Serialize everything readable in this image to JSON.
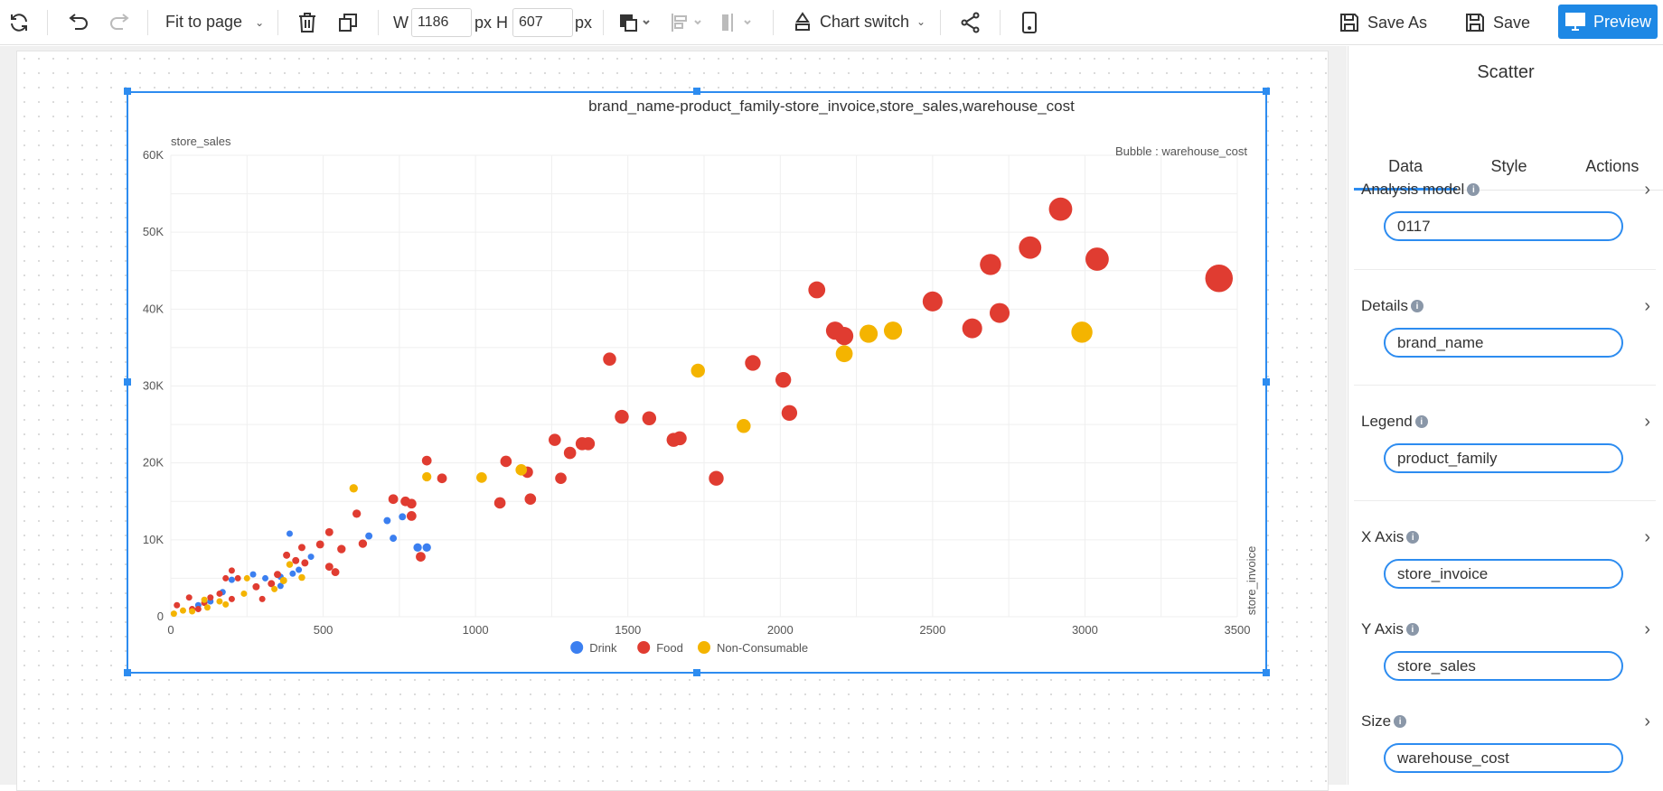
{
  "toolbar": {
    "zoom": "Fit to page",
    "w_label": "W",
    "width_value": "1186",
    "px1": "px",
    "h_label": "H",
    "height_value": "607",
    "px2": "px",
    "chart_switch": "Chart switch",
    "save_as": "Save As",
    "save": "Save",
    "preview": "Preview"
  },
  "chart": {
    "title": "brand_name-product_family-store_invoice,store_sales,warehouse_cost",
    "ylabel": "store_sales",
    "xlabel": "store_invoice",
    "bubble_note": "Bubble : warehouse_cost"
  },
  "chart_data": {
    "type": "scatter",
    "title": "brand_name-product_family-store_invoice,store_sales,warehouse_cost",
    "xlabel": "store_invoice",
    "ylabel": "store_sales",
    "size_label": "Bubble : warehouse_cost",
    "xlim": [
      0,
      3500
    ],
    "ylim": [
      0,
      60000
    ],
    "x_ticks": [
      "0",
      "500",
      "1000",
      "1500",
      "2000",
      "2500",
      "3000",
      "3500"
    ],
    "y_ticks": [
      "0",
      "10K",
      "20K",
      "30K",
      "40K",
      "50K",
      "60K"
    ],
    "legend_position": "bottom",
    "grid": true,
    "series": [
      {
        "name": "Drink",
        "color": "#3b7ff0",
        "points": [
          [
            390,
            10800,
            1
          ],
          [
            650,
            10500,
            1.2
          ],
          [
            710,
            12500,
            1.2
          ],
          [
            760,
            13000,
            1.2
          ],
          [
            730,
            10200,
            1.2
          ],
          [
            810,
            9000,
            1.5
          ],
          [
            840,
            9000,
            1.5
          ],
          [
            460,
            7800,
            1
          ],
          [
            420,
            6100,
            1
          ],
          [
            400,
            5600,
            1
          ],
          [
            360,
            5200,
            1
          ],
          [
            310,
            5000,
            1
          ],
          [
            270,
            5500,
            1
          ],
          [
            200,
            4800,
            1
          ],
          [
            170,
            3200,
            1
          ],
          [
            360,
            4000,
            1
          ],
          [
            130,
            2000,
            1
          ],
          [
            90,
            1500,
            1
          ]
        ]
      },
      {
        "name": "Food",
        "color": "#e03c31",
        "points": [
          [
            3440,
            44000,
            6
          ],
          [
            2920,
            53000,
            5
          ],
          [
            3040,
            46500,
            5
          ],
          [
            2820,
            48000,
            4.8
          ],
          [
            2690,
            45800,
            4.5
          ],
          [
            2500,
            41000,
            4.2
          ],
          [
            2720,
            39500,
            4.2
          ],
          [
            2630,
            37500,
            4.2
          ],
          [
            2120,
            42500,
            3.5
          ],
          [
            2180,
            37200,
            3.8
          ],
          [
            2210,
            36500,
            3.8
          ],
          [
            1910,
            33000,
            3.2
          ],
          [
            2010,
            30800,
            3.2
          ],
          [
            2030,
            26500,
            3.2
          ],
          [
            1440,
            33500,
            2.6
          ],
          [
            1480,
            26000,
            2.8
          ],
          [
            1570,
            25800,
            2.8
          ],
          [
            1650,
            23000,
            2.8
          ],
          [
            1670,
            23200,
            2.8
          ],
          [
            1790,
            18000,
            3
          ],
          [
            1260,
            23000,
            2.4
          ],
          [
            1310,
            21300,
            2.4
          ],
          [
            1350,
            22500,
            2.6
          ],
          [
            1370,
            22500,
            2.6
          ],
          [
            1280,
            18000,
            2.2
          ],
          [
            1100,
            20200,
            2.2
          ],
          [
            1170,
            18800,
            2.2
          ],
          [
            1180,
            15300,
            2.2
          ],
          [
            1080,
            14800,
            2.2
          ],
          [
            840,
            20300,
            1.8
          ],
          [
            890,
            18000,
            1.8
          ],
          [
            770,
            15000,
            1.8
          ],
          [
            730,
            15300,
            1.8
          ],
          [
            790,
            14700,
            1.8
          ],
          [
            790,
            13100,
            1.8
          ],
          [
            820,
            7800,
            1.8
          ],
          [
            610,
            13400,
            1.5
          ],
          [
            560,
            8800,
            1.5
          ],
          [
            630,
            9500,
            1.5
          ],
          [
            520,
            11000,
            1.4
          ],
          [
            490,
            9400,
            1.4
          ],
          [
            520,
            6500,
            1.4
          ],
          [
            540,
            5800,
            1.4
          ],
          [
            440,
            7000,
            1.2
          ],
          [
            430,
            9000,
            1.2
          ],
          [
            380,
            8000,
            1.2
          ],
          [
            410,
            7300,
            1.2
          ],
          [
            350,
            5500,
            1.2
          ],
          [
            330,
            4300,
            1.2
          ],
          [
            280,
            3900,
            1.2
          ],
          [
            200,
            6000,
            1
          ],
          [
            180,
            5000,
            1
          ],
          [
            220,
            5000,
            1
          ],
          [
            160,
            3000,
            1
          ],
          [
            130,
            2500,
            1
          ],
          [
            110,
            1800,
            1
          ],
          [
            90,
            1000,
            1
          ],
          [
            60,
            2500,
            1
          ],
          [
            20,
            1500,
            1
          ],
          [
            300,
            2300,
            1
          ],
          [
            200,
            2300,
            1
          ],
          [
            70,
            1000,
            1
          ]
        ]
      },
      {
        "name": "Non-Consumable",
        "color": "#f4b400",
        "points": [
          [
            2990,
            37000,
            4.5
          ],
          [
            2370,
            37200,
            3.8
          ],
          [
            2290,
            36800,
            3.8
          ],
          [
            2210,
            34200,
            3.5
          ],
          [
            1730,
            32000,
            2.8
          ],
          [
            1880,
            24800,
            2.8
          ],
          [
            1150,
            19100,
            2.2
          ],
          [
            1020,
            18100,
            2
          ],
          [
            840,
            18200,
            1.7
          ],
          [
            600,
            16700,
            1.5
          ],
          [
            370,
            4700,
            1.2
          ],
          [
            390,
            6800,
            1.1
          ],
          [
            430,
            5100,
            1.1
          ],
          [
            250,
            5000,
            1
          ],
          [
            240,
            3000,
            1
          ],
          [
            180,
            1600,
            1
          ],
          [
            120,
            1200,
            1
          ],
          [
            70,
            700,
            1
          ],
          [
            40,
            800,
            1
          ],
          [
            10,
            400,
            1
          ],
          [
            110,
            2200,
            1
          ],
          [
            160,
            2000,
            1
          ],
          [
            340,
            3600,
            1
          ]
        ]
      }
    ]
  },
  "panel": {
    "title": "Scatter",
    "tabs": [
      "Data",
      "Style",
      "Actions"
    ],
    "fields": [
      {
        "label": "Analysis model",
        "value": "0117"
      },
      {
        "label": "Details",
        "value": "brand_name"
      },
      {
        "label": "Legend",
        "value": "product_family"
      },
      {
        "label": "X Axis",
        "value": "store_invoice"
      },
      {
        "label": "Y Axis",
        "value": "store_sales"
      },
      {
        "label": "Size",
        "value": "warehouse_cost"
      }
    ]
  }
}
